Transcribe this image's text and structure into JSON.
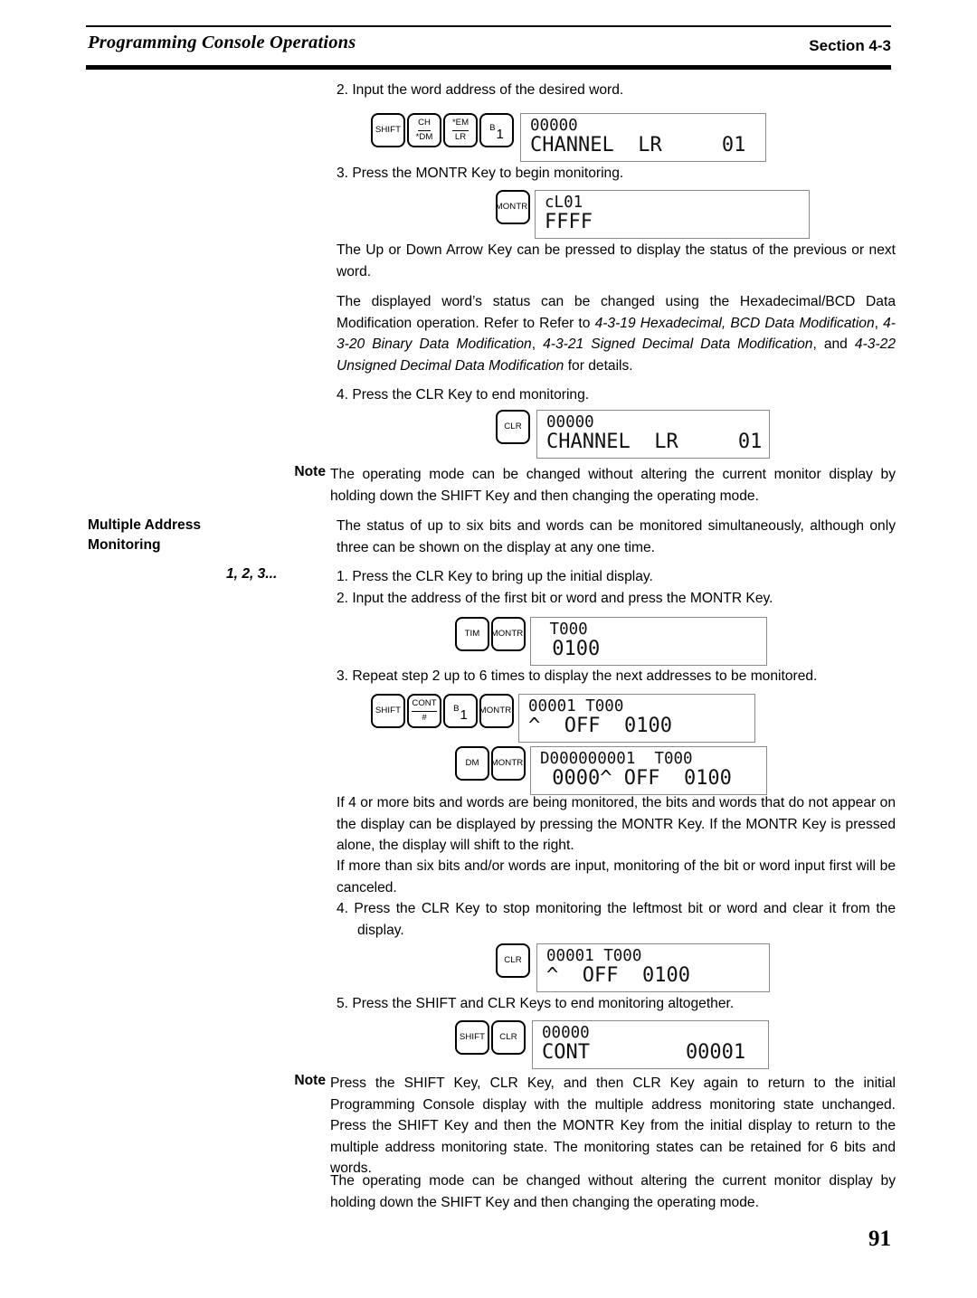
{
  "header": {
    "title": "Programming Console Operations",
    "section": "Section 4-3"
  },
  "folio": "91",
  "steps": {
    "s2_input_word": "2. Input the word address of the desired word.",
    "s3_press_montr": "3.  Press the MONTR Key to begin monitoring.",
    "s4_press_clr": "4. Press the CLR Key to end monitoring.",
    "m1_press_clr": "1. Press the CLR Key to bring up the initial display.",
    "m2_input_addr": "2. Input the address of the first bit or word and press the MONTR Key.",
    "m3_repeat": "3. Repeat step 2 up to 6 times to display the next addresses to be monitored.",
    "m4_press_clr": "4. Press the CLR Key to stop monitoring the leftmost bit or word and clear it from the display.",
    "m5_shift_clr": "5. Press the SHIFT and CLR Keys to end monitoring altogether."
  },
  "paragraphs": {
    "arrow_keys": "The Up or Down Arrow Key can be pressed to display the status of the previous or next word.",
    "data_mod_pre": "The displayed word’s status can be changed using the Hexadecimal/BCD Data Modification operation. Refer to Refer to ",
    "data_mod_i1": "4-3-19 Hexadecimal, BCD Data Modification",
    "data_mod_sep1": ", ",
    "data_mod_i2": "4-3-20 Binary Data Modification",
    "data_mod_sep2": ", ",
    "data_mod_i3": "4-3-21 Signed Decimal Data Modification",
    "data_mod_sep3": ", and ",
    "data_mod_i4": "4-3-22 Unsigned Decimal Data Modification",
    "data_mod_post": " for details.",
    "four_or_more": "If 4 or more bits and words are being monitored, the bits and words that do not appear on the display can be displayed by pressing the MONTR Key. If the MONTR Key is pressed alone, the display will shift to the right.",
    "more_than_six": "If more than six bits and/or words are input, monitoring of the bit or word input first will be canceled."
  },
  "note1": {
    "label": "Note",
    "text": "The operating mode can be changed without altering the current monitor display by holding down the SHIFT Key and then changing the operating mode."
  },
  "note2": {
    "label": "Note",
    "para1": "Press the SHIFT Key, CLR Key, and then CLR Key again to return to the initial Programming Console display with the multiple address monitoring state unchanged. Press the SHIFT Key and then the MONTR Key from the initial display to return to the multiple address monitoring state. The monitoring states can be retained for 6 bits and words.",
    "para2": "The operating mode can be changed without altering the current monitor display by holding down the SHIFT Key and then changing the operating mode."
  },
  "margin": {
    "heading_line1": "Multiple Address",
    "heading_line2": "Monitoring",
    "list_label": "1, 2, 3...",
    "intro": "The status of up to six bits and words can be monitored simultaneously, although only three can be shown on the display at any one time."
  },
  "keys": {
    "shift": "SHIFT",
    "montr": "MONTR",
    "clr": "CLR",
    "tim": "TIM",
    "dm": "DM",
    "ch_top": "CH",
    "ch_bot": "*DM",
    "em_top": "*EM",
    "em_bot": "LR",
    "cont_top": "CONT",
    "cont_bot": "#",
    "b_small": "B",
    "b_big": "1"
  },
  "figures": [
    {
      "id": "fig-channel-lr-input",
      "keys": [
        "shift",
        "ch_dm",
        "em_lr",
        "b1"
      ],
      "lcd_line1": "00000",
      "lcd_line2": "CHANNEL  LR     01",
      "lcd_width": 275
    },
    {
      "id": "fig-montr-cl01",
      "keys": [
        "montr"
      ],
      "lcd_line1": "cL01",
      "lcd_line2": "FFFF",
      "lcd_width": 305
    },
    {
      "id": "fig-clr-channel-lr",
      "keys": [
        "clr"
      ],
      "lcd_line1": "00000",
      "lcd_line2": "CHANNEL  LR     01",
      "lcd_width": 260
    },
    {
      "id": "fig-tim-montr-t000",
      "keys": [
        "tim",
        "montr"
      ],
      "lcd_line1": " T000",
      "lcd_line2": " 0100",
      "lcd_width": 265
    },
    {
      "id": "fig-shift-cont-b1-montr",
      "keys": [
        "shift",
        "cont_hash",
        "b1",
        "montr"
      ],
      "lcd_line1": "00001 T000",
      "lcd_line2": "^  OFF  0100",
      "lcd_width": 265
    },
    {
      "id": "fig-dm-montr-d000000001",
      "keys": [
        "dm",
        "montr"
      ],
      "lcd_line1": "D000000001  T000",
      "lcd_line2": " 0000^ OFF  0100",
      "lcd_width": 265
    },
    {
      "id": "fig-clr-stop-leftmost",
      "keys": [
        "clr"
      ],
      "lcd_line1": "00001 T000",
      "lcd_line2": "^  OFF  0100",
      "lcd_width": 260
    },
    {
      "id": "fig-shift-clr-cont",
      "keys": [
        "shift",
        "clr"
      ],
      "lcd_line1": "00000",
      "lcd_line2": "CONT        00001",
      "lcd_width": 265
    }
  ]
}
